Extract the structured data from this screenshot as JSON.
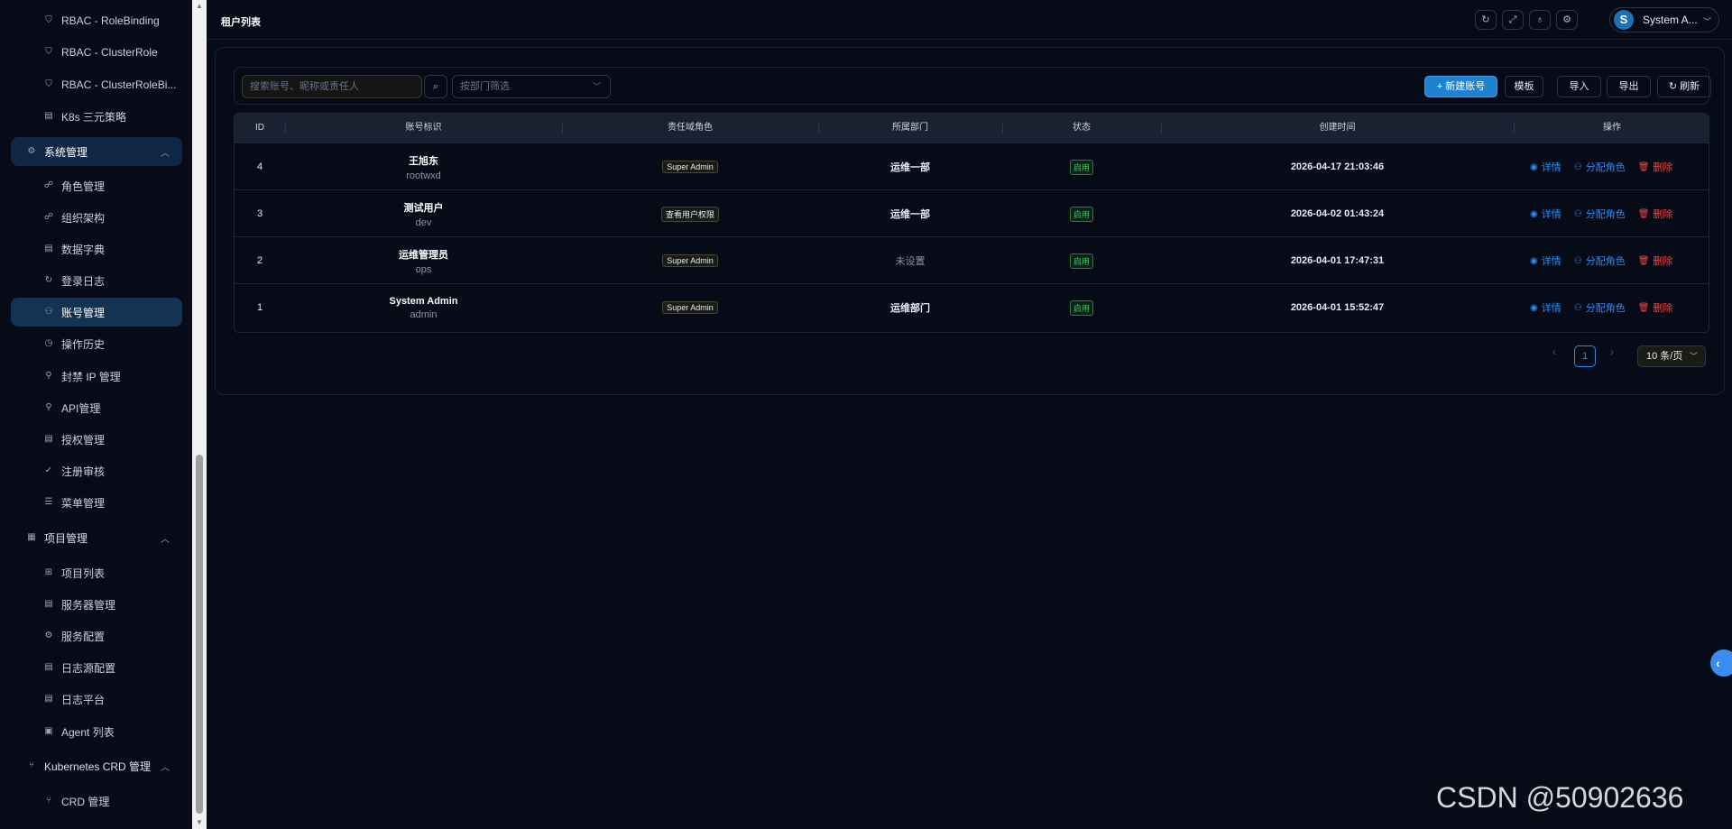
{
  "sidebar": {
    "items": [
      {
        "label": "RBAC - RoleBinding",
        "icon": "shield-icon"
      },
      {
        "label": "RBAC - ClusterRole",
        "icon": "shield-icon"
      },
      {
        "label": "RBAC - ClusterRoleBi...",
        "icon": "shield-icon"
      },
      {
        "label": "K8s 三元策略",
        "icon": "policy-icon"
      },
      {
        "label": "系统管理",
        "icon": "gear-icon"
      },
      {
        "label": "角色管理",
        "icon": "role-icon"
      },
      {
        "label": "组织架构",
        "icon": "org-icon"
      },
      {
        "label": "数据字典",
        "icon": "dictionary-icon"
      },
      {
        "label": "登录日志",
        "icon": "login-log-icon"
      },
      {
        "label": "账号管理",
        "icon": "account-icon"
      },
      {
        "label": "操作历史",
        "icon": "history-icon"
      },
      {
        "label": "封禁 IP 管理",
        "icon": "ban-icon"
      },
      {
        "label": "API管理",
        "icon": "api-icon"
      },
      {
        "label": "授权管理",
        "icon": "license-icon"
      },
      {
        "label": "注册审核",
        "icon": "check-circle-icon"
      },
      {
        "label": "菜单管理",
        "icon": "menu-icon"
      },
      {
        "label": "项目管理",
        "icon": "project-icon"
      },
      {
        "label": "项目列表",
        "icon": "grid-icon"
      },
      {
        "label": "服务器管理",
        "icon": "server-icon"
      },
      {
        "label": "服务配置",
        "icon": "gear-icon"
      },
      {
        "label": "日志源配置",
        "icon": "log-source-icon"
      },
      {
        "label": "日志平台",
        "icon": "log-platform-icon"
      },
      {
        "label": "Agent 列表",
        "icon": "agent-icon"
      },
      {
        "label": "Kubernetes CRD 管理",
        "icon": "branch-icon"
      },
      {
        "label": "CRD 管理",
        "icon": "branch-icon"
      }
    ]
  },
  "header": {
    "title": "租户列表",
    "user_initial": "S",
    "user_name": "System A..."
  },
  "toolbar": {
    "search_placeholder": "搜索账号、昵称或责任人",
    "dept_placeholder": "按部门筛选",
    "new_label": "+ 新建账号",
    "template_label": "模板",
    "import_label": "导入",
    "export_label": "导出",
    "refresh_label": "刷新"
  },
  "table": {
    "columns": [
      "ID",
      "账号标识",
      "责任域角色",
      "所属部门",
      "状态",
      "创建时间",
      "操作"
    ],
    "rows": [
      {
        "id": "4",
        "name": "王旭东",
        "account": "rootwxd",
        "role": "Super Admin",
        "dept": "运维一部",
        "status": "启用",
        "created": "2026-04-17 21:03:46"
      },
      {
        "id": "3",
        "name": "测试用户",
        "account": "dev",
        "role": "查看用户权限",
        "dept": "运维一部",
        "status": "启用",
        "created": "2026-04-02 01:43:24"
      },
      {
        "id": "2",
        "name": "运维管理员",
        "account": "ops",
        "role": "Super Admin",
        "dept": "未设置",
        "status": "启用",
        "created": "2026-04-01 17:47:31"
      },
      {
        "id": "1",
        "name": "System Admin",
        "account": "admin",
        "role": "Super Admin",
        "dept": "运维部门",
        "status": "启用",
        "created": "2026-04-01 15:52:47"
      }
    ],
    "actions": {
      "detail": "详情",
      "assign": "分配角色",
      "delete": "删除"
    }
  },
  "pagination": {
    "current_page": "1",
    "page_size": "10 条/页"
  },
  "watermark": "CSDN @50902636",
  "colors": {
    "accent": "#2e8cf0",
    "danger": "#e94a4a",
    "success": "#3ec46d",
    "active_nav": "#143353",
    "background": "#070b18"
  }
}
